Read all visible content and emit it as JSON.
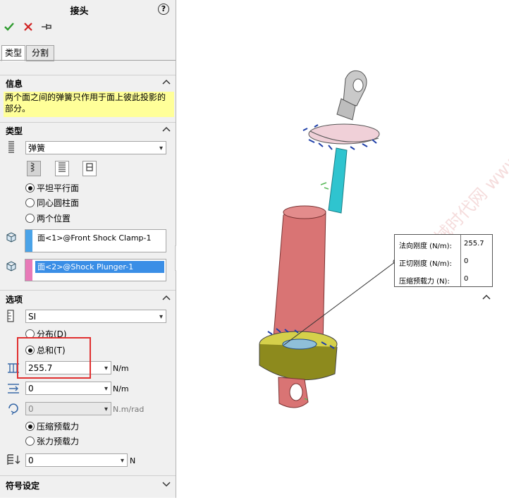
{
  "panel": {
    "title": "接头",
    "help_icon": "?",
    "tabs": [
      "类型",
      "分割"
    ],
    "info": {
      "header": "信息",
      "message": "两个面之间的弹簧只作用于面上彼此投影的部分。"
    },
    "type_section": {
      "header": "类型",
      "connector_type": "弹簧",
      "face_options": [
        "平坦平行面",
        "同心圆柱面",
        "两个位置"
      ],
      "selected_face_option": "平坦平行面",
      "face1": "面<1>@Front Shock Clamp-1",
      "face2": "面<2>@Shock Plunger-1"
    },
    "options_section": {
      "header": "选项",
      "unit_system": "SI",
      "dist_options": [
        "分布(D)",
        "总和(T)"
      ],
      "selected_dist": "总和(T)",
      "normal_stiffness": "255.7",
      "normal_unit": "N/m",
      "tangential_stiffness": "0",
      "tangential_unit": "N/m",
      "rotational_stiffness": "0",
      "rotational_unit": "N.m/rad",
      "preload_options": [
        "压缩预载力",
        "张力预载力"
      ],
      "selected_preload": "压缩预载力",
      "preload_value": "0",
      "preload_unit": "N"
    },
    "symbol_section": {
      "header": "符号设定"
    }
  },
  "viewport": {
    "callout": [
      {
        "label": "法向刚度 (N/m):",
        "value": "255.7"
      },
      {
        "label": "正切刚度 (N/m):",
        "value": "0"
      },
      {
        "label": "压缩预载力 (N):",
        "value": "0"
      }
    ],
    "watermark": "机械时代网 www.jxage.com"
  },
  "colors": {
    "accept": "#2e9b2e",
    "cancel": "#d02020",
    "highlight": "#ffff99",
    "face1_bar": "#4aa3e8",
    "face2_bar": "#e87ab8",
    "red_box": "#e03030"
  }
}
